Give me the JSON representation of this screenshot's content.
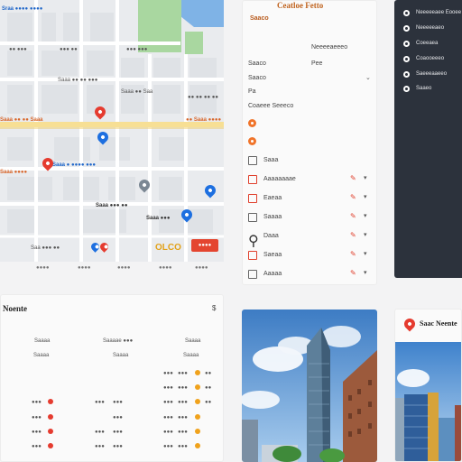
{
  "map": {
    "labels": {
      "top_left": "Sraa ●●●● ●●●●",
      "road1": "Saaa ●● ●● ●●●",
      "road2": "Saaa ●● Saa",
      "road3": "Saaa ●● ●● Saaa",
      "road4": "●● Saaa ●●●●",
      "road5": "Saa ●●● ●●",
      "place1": "●● ●● ●● ●●",
      "blue_label": "Saaa ● ●●●● ●●●",
      "orange_label": "Saaa ●●●●",
      "mid_label": "Saaa ●●● ●●",
      "dark_label": "Saaa ●●●",
      "street_a": "●● ●●●",
      "street_b": "●●● ●●",
      "street_c": "●●● ●●●"
    },
    "price": "OLCO",
    "action_button": "●●●●",
    "bottom_row": [
      "●●●●",
      "●●●●",
      "●●●●",
      "●●●●",
      "●●●●"
    ]
  },
  "panel": {
    "header": "Ceatloe Fetto",
    "title": "Saaco",
    "fields": {
      "f1_label": "Saaco",
      "f1_value": "Neeeeaeeeo",
      "f2_label": "Saaco",
      "f2_value": "Pee",
      "f3_label": "Saaco",
      "f4_label": "Pa",
      "f5_label": "Coaeee Seeeco"
    },
    "rows": [
      {
        "label": "Saaa",
        "icon": "list-icon"
      },
      {
        "label": "Aaaaaaaae",
        "icon": "calendar-icon"
      },
      {
        "label": "Eaeaa",
        "icon": "calendar-icon"
      },
      {
        "label": "Saaaa",
        "icon": "list-icon"
      },
      {
        "label": "Daaa",
        "icon": "person-icon"
      },
      {
        "label": "Saeaa",
        "icon": "calendar-icon"
      },
      {
        "label": "Aaaaa",
        "icon": "list-icon"
      }
    ]
  },
  "sidebar": {
    "items": [
      "Neeeeeaee Eooee",
      "Neeeeeaeo",
      "Coeeaea",
      "Coaooeeeo",
      "Saeeeaaeeo",
      "Saaeo"
    ]
  },
  "table": {
    "title": "Noente",
    "more": "$",
    "headers": [
      "Saaaa",
      "Saaaae ●●●",
      "Saaaa"
    ],
    "subheaders": [
      "Saaaa",
      "Saaaa",
      "Saaaa"
    ],
    "rows": [
      {
        "a": "",
        "b": "",
        "c": "●●●",
        "d": "●●●",
        "dot": "yellow"
      },
      {
        "a": "",
        "b": "",
        "c": "●●●",
        "d": "●●●",
        "dot": "yellow"
      },
      {
        "a": "●●●",
        "b": "●●●",
        "c": "●●●",
        "d": "●●●",
        "dot": "red"
      },
      {
        "a": "●●●",
        "b": "●●●",
        "c": "●●●",
        "d": "●●●",
        "dot": "red"
      },
      {
        "a": "●●●",
        "b": "●●●",
        "c": "●●●",
        "d": "●●●",
        "dot": "red"
      },
      {
        "a": "●●●",
        "b": "●●●",
        "c": "●●●",
        "d": "●●●",
        "dot": "red"
      }
    ]
  },
  "card2": {
    "title": "Saac Neente"
  },
  "colors": {
    "accent_orange": "#f0742a",
    "accent_red": "#e53b2f",
    "map_blue": "#1d6fe0",
    "sidebar_bg": "#2c323c"
  }
}
